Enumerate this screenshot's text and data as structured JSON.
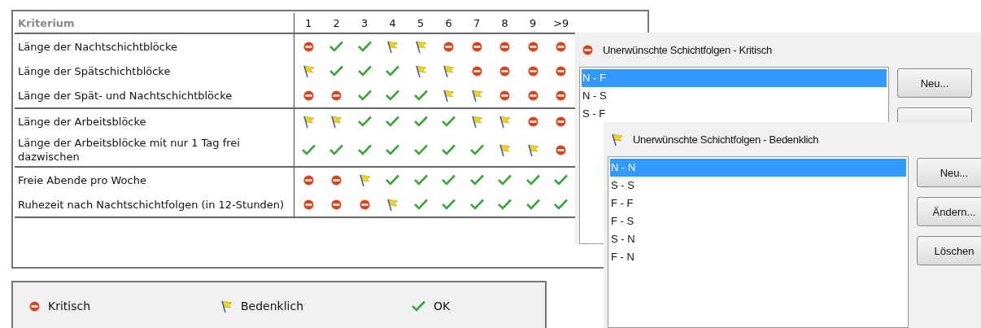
{
  "table": {
    "header": "Kriterium",
    "columns": [
      "1",
      "2",
      "3",
      "4",
      "5",
      "6",
      "7",
      "8",
      "9",
      ">9"
    ],
    "groups": [
      {
        "rows": [
          {
            "label": "Länge der Nachtschichtblöcke",
            "ratings": [
              {
                "kind": "critical"
              },
              {
                "kind": "ok"
              },
              {
                "kind": "ok"
              },
              {
                "kind": "warning"
              },
              {
                "kind": "warning"
              },
              {
                "kind": "critical"
              },
              {
                "kind": "critical"
              },
              {
                "kind": "critical"
              },
              {
                "kind": "critical"
              },
              {
                "kind": "critical"
              }
            ]
          },
          {
            "label": "Länge der Spätschichtblöcke",
            "ratings": [
              {
                "kind": "warning"
              },
              {
                "kind": "ok"
              },
              {
                "kind": "ok"
              },
              {
                "kind": "ok"
              },
              {
                "kind": "warning"
              },
              {
                "kind": "warning"
              },
              {
                "kind": "critical"
              },
              {
                "kind": "critical"
              },
              {
                "kind": "critical"
              },
              {
                "kind": "critical"
              }
            ]
          },
          {
            "label": "Länge der Spät- und Nachtschichtblöcke",
            "ratings": [
              {
                "kind": "critical"
              },
              {
                "kind": "critical"
              },
              {
                "kind": "ok"
              },
              {
                "kind": "ok"
              },
              {
                "kind": "ok"
              },
              {
                "kind": "warning"
              },
              {
                "kind": "warning"
              },
              {
                "kind": "critical"
              },
              {
                "kind": "critical"
              },
              {
                "kind": "critical"
              }
            ]
          }
        ]
      },
      {
        "rows": [
          {
            "label": "Länge der Arbeitsblöcke",
            "ratings": [
              {
                "kind": "warning"
              },
              {
                "kind": "warning"
              },
              {
                "kind": "ok"
              },
              {
                "kind": "ok"
              },
              {
                "kind": "ok"
              },
              {
                "kind": "ok"
              },
              {
                "kind": "warning"
              },
              {
                "kind": "warning"
              },
              {
                "kind": "critical"
              },
              {
                "kind": "critical"
              }
            ]
          },
          {
            "label": "Länge der Arbeitsblöcke mit nur 1 Tag frei dazwischen",
            "ratings": [
              {
                "kind": "ok"
              },
              {
                "kind": "ok"
              },
              {
                "kind": "ok"
              },
              {
                "kind": "ok"
              },
              {
                "kind": "ok"
              },
              {
                "kind": "ok"
              },
              {
                "kind": "ok"
              },
              {
                "kind": "warning"
              },
              {
                "kind": "warning"
              },
              {
                "kind": "critical"
              }
            ]
          }
        ]
      },
      {
        "rows": [
          {
            "label": "Freie Abende pro Woche",
            "ratings": [
              {
                "kind": "critical"
              },
              {
                "kind": "critical"
              },
              {
                "kind": "warning"
              },
              {
                "kind": "ok"
              },
              {
                "kind": "ok"
              },
              {
                "kind": "ok"
              },
              {
                "kind": "ok"
              },
              {
                "kind": "ok"
              },
              {
                "kind": "ok"
              },
              {
                "kind": "ok"
              }
            ]
          },
          {
            "label": "Ruhezeit nach Nachtschichtfolgen (in 12-Stunden)",
            "ratings": [
              {
                "kind": "critical"
              },
              {
                "kind": "critical"
              },
              {
                "kind": "critical"
              },
              {
                "kind": "warning"
              },
              {
                "kind": "ok"
              },
              {
                "kind": "ok"
              },
              {
                "kind": "ok"
              },
              {
                "kind": "ok"
              },
              {
                "kind": "ok"
              },
              {
                "kind": "ok"
              }
            ]
          }
        ]
      }
    ]
  },
  "legend": [
    {
      "kind": "critical",
      "label": "Kritisch"
    },
    {
      "kind": "warning",
      "label": "Bedenklich"
    },
    {
      "kind": "ok",
      "label": "OK"
    }
  ],
  "dialogs": [
    {
      "kind": "critical",
      "title": "Unerwünschte Schichtfolgen - Kritisch",
      "items": [
        {
          "label": "N - F",
          "selected": true
        },
        {
          "label": "N - S",
          "selected": false
        },
        {
          "label": "S - F",
          "selected": false
        }
      ],
      "buttons": [
        {
          "kind": "button",
          "label": "Neu..."
        },
        {
          "kind": "covered"
        }
      ]
    },
    {
      "kind": "warning",
      "title": "Unerwünschte Schichtfolgen - Bedenklich",
      "items": [
        {
          "label": "N - N",
          "selected": true
        },
        {
          "label": "S - S",
          "selected": false
        },
        {
          "label": "F - F",
          "selected": false
        },
        {
          "label": "F - S",
          "selected": false
        },
        {
          "label": "S - N",
          "selected": false
        },
        {
          "label": "F - N",
          "selected": false
        }
      ],
      "buttons": [
        {
          "kind": "button",
          "label": "Neu..."
        },
        {
          "kind": "button",
          "label": "Ändern..."
        },
        {
          "kind": "button",
          "label": "Löschen"
        }
      ]
    }
  ]
}
